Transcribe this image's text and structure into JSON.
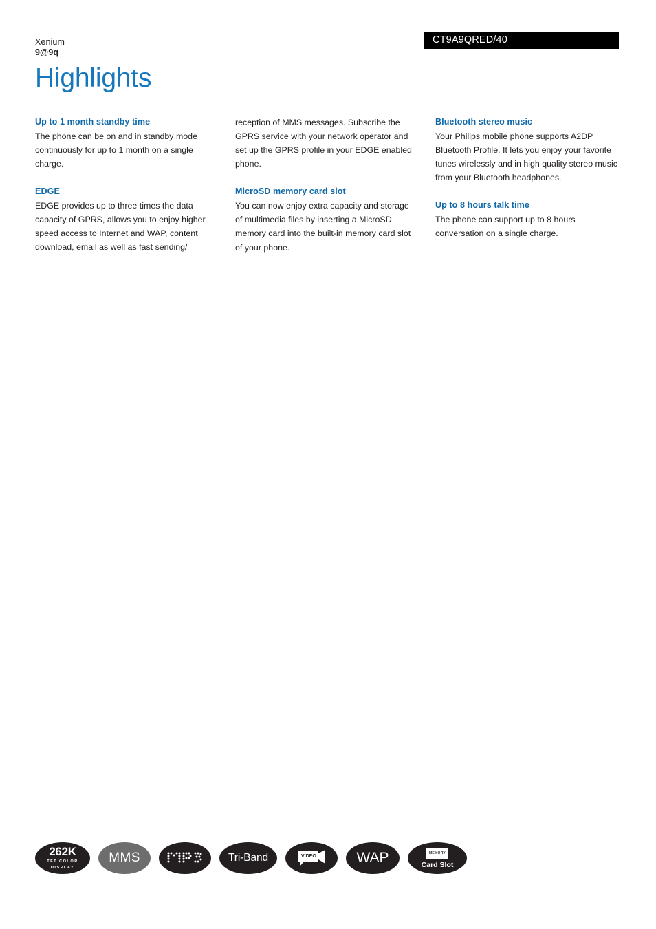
{
  "header": {
    "brand_line1": "Xenium",
    "brand_line2": "9@9q",
    "product_code": "CT9A9QRED/40",
    "page_title": "Highlights",
    "title_color": "#1577bd",
    "heading_color": "#1069a9",
    "code_bar_bg": "#000000"
  },
  "columns": [
    {
      "blocks": [
        {
          "heading": "Up to 1 month standby time",
          "body": "The phone can be on and in standby mode continuously for up to 1 month on a single charge."
        },
        {
          "heading": "EDGE",
          "body": "EDGE provides up to three times the data capacity of GPRS, allows you to enjoy higher speed access to Internet and WAP, content download, email as well as fast sending/"
        }
      ]
    },
    {
      "continuation": "reception of MMS messages. Subscribe the GPRS service with your network operator and set up the GPRS profile in your EDGE enabled phone.",
      "blocks": [
        {
          "heading": "MicroSD memory card slot",
          "body": "You can now enjoy extra capacity and storage of multimedia files by inserting a MicroSD memory card into the built-in memory card slot of your phone."
        }
      ]
    },
    {
      "blocks": [
        {
          "heading": "Bluetooth stereo music",
          "body": "Your Philips mobile phone supports A2DP Bluetooth Profile. It lets you enjoy your favorite tunes wirelessly and in high quality stereo music from your Bluetooth headphones."
        },
        {
          "heading": "Up to 8 hours talk time",
          "body": "The phone can support up to 8 hours conversation on a single charge."
        }
      ]
    }
  ],
  "badges": [
    {
      "icon": "display-262k-badge-icon",
      "line1": "262K",
      "line2": "TFT COLOR",
      "line3": "DISPLAY",
      "color": "#231f20"
    },
    {
      "icon": "mms-badge-icon",
      "line1": "MMS",
      "color": "#6d6d6d"
    },
    {
      "icon": "mp3-badge-icon",
      "line1": "MP3",
      "color": "#231f20"
    },
    {
      "icon": "tri-band-badge-icon",
      "line1": "Tri-Band",
      "color": "#231f20"
    },
    {
      "icon": "video-badge-icon",
      "line1": "VIDEO",
      "color": "#231f20"
    },
    {
      "icon": "wap-badge-icon",
      "line1": "WAP",
      "color": "#231f20"
    },
    {
      "icon": "memory-card-slot-badge-icon",
      "line1": "MEMORY",
      "line2": "Card Slot",
      "color": "#231f20"
    }
  ]
}
